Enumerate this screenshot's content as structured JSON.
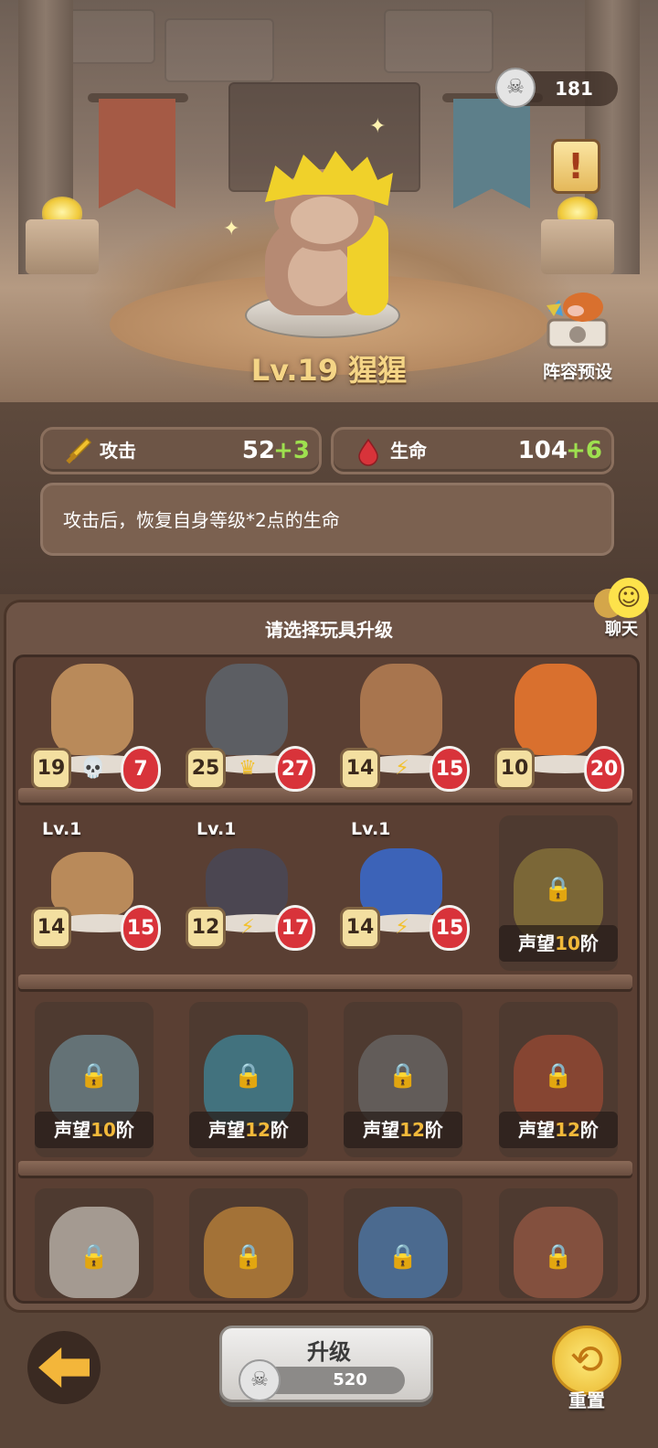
{
  "currency": {
    "icon": "skull-token-icon",
    "value": "181"
  },
  "hero": {
    "title": "Lv.19 猩猩"
  },
  "lineup": {
    "label": "阵容预设"
  },
  "stats": {
    "attack": {
      "label": "攻击",
      "value": "52",
      "bonus": "+3",
      "icon": "sword-icon"
    },
    "health": {
      "label": "生命",
      "value": "104",
      "bonus": "+6",
      "icon": "blood-drop-icon"
    }
  },
  "description": "攻击后，恢复自身等级*2点的生命",
  "panel": {
    "title": "请选择玩具升级"
  },
  "chat": {
    "label": "聊天"
  },
  "toys_row1": [
    {
      "atk": "19",
      "hp": "7",
      "trait": "skull-icon",
      "color": "#b98a5a"
    },
    {
      "atk": "25",
      "hp": "27",
      "trait": "crown-icon",
      "color": "#5c5e63"
    },
    {
      "atk": "14",
      "hp": "15",
      "trait": "lightning-icon",
      "color": "#a8754e"
    },
    {
      "atk": "10",
      "hp": "20",
      "trait": "",
      "color": "#d9702e"
    }
  ],
  "toys_row2": [
    {
      "level": "Lv.1",
      "atk": "14",
      "hp": "15",
      "trait": "",
      "color": "#b98a5a"
    },
    {
      "level": "Lv.1",
      "atk": "12",
      "hp": "17",
      "trait": "lightning-icon",
      "color": "#4b4651"
    },
    {
      "level": "Lv.1",
      "atk": "14",
      "hp": "15",
      "trait": "lightning-icon",
      "color": "#3c63b8"
    }
  ],
  "locked": [
    {
      "prefix": "声望",
      "num": "10",
      "suffix": "阶",
      "color": "#8f7a3a"
    },
    {
      "prefix": "声望",
      "num": "10",
      "suffix": "阶",
      "color": "#6e8a94"
    },
    {
      "prefix": "声望",
      "num": "12",
      "suffix": "阶",
      "color": "#3d8aa0"
    },
    {
      "prefix": "声望",
      "num": "12",
      "suffix": "阶",
      "color": "#6b6b6b"
    },
    {
      "prefix": "声望",
      "num": "12",
      "suffix": "阶",
      "color": "#9e4a33"
    }
  ],
  "upgrade": {
    "label": "升级",
    "cost": "520",
    "icon": "skull-token-icon"
  },
  "reset": {
    "label": "重置"
  }
}
